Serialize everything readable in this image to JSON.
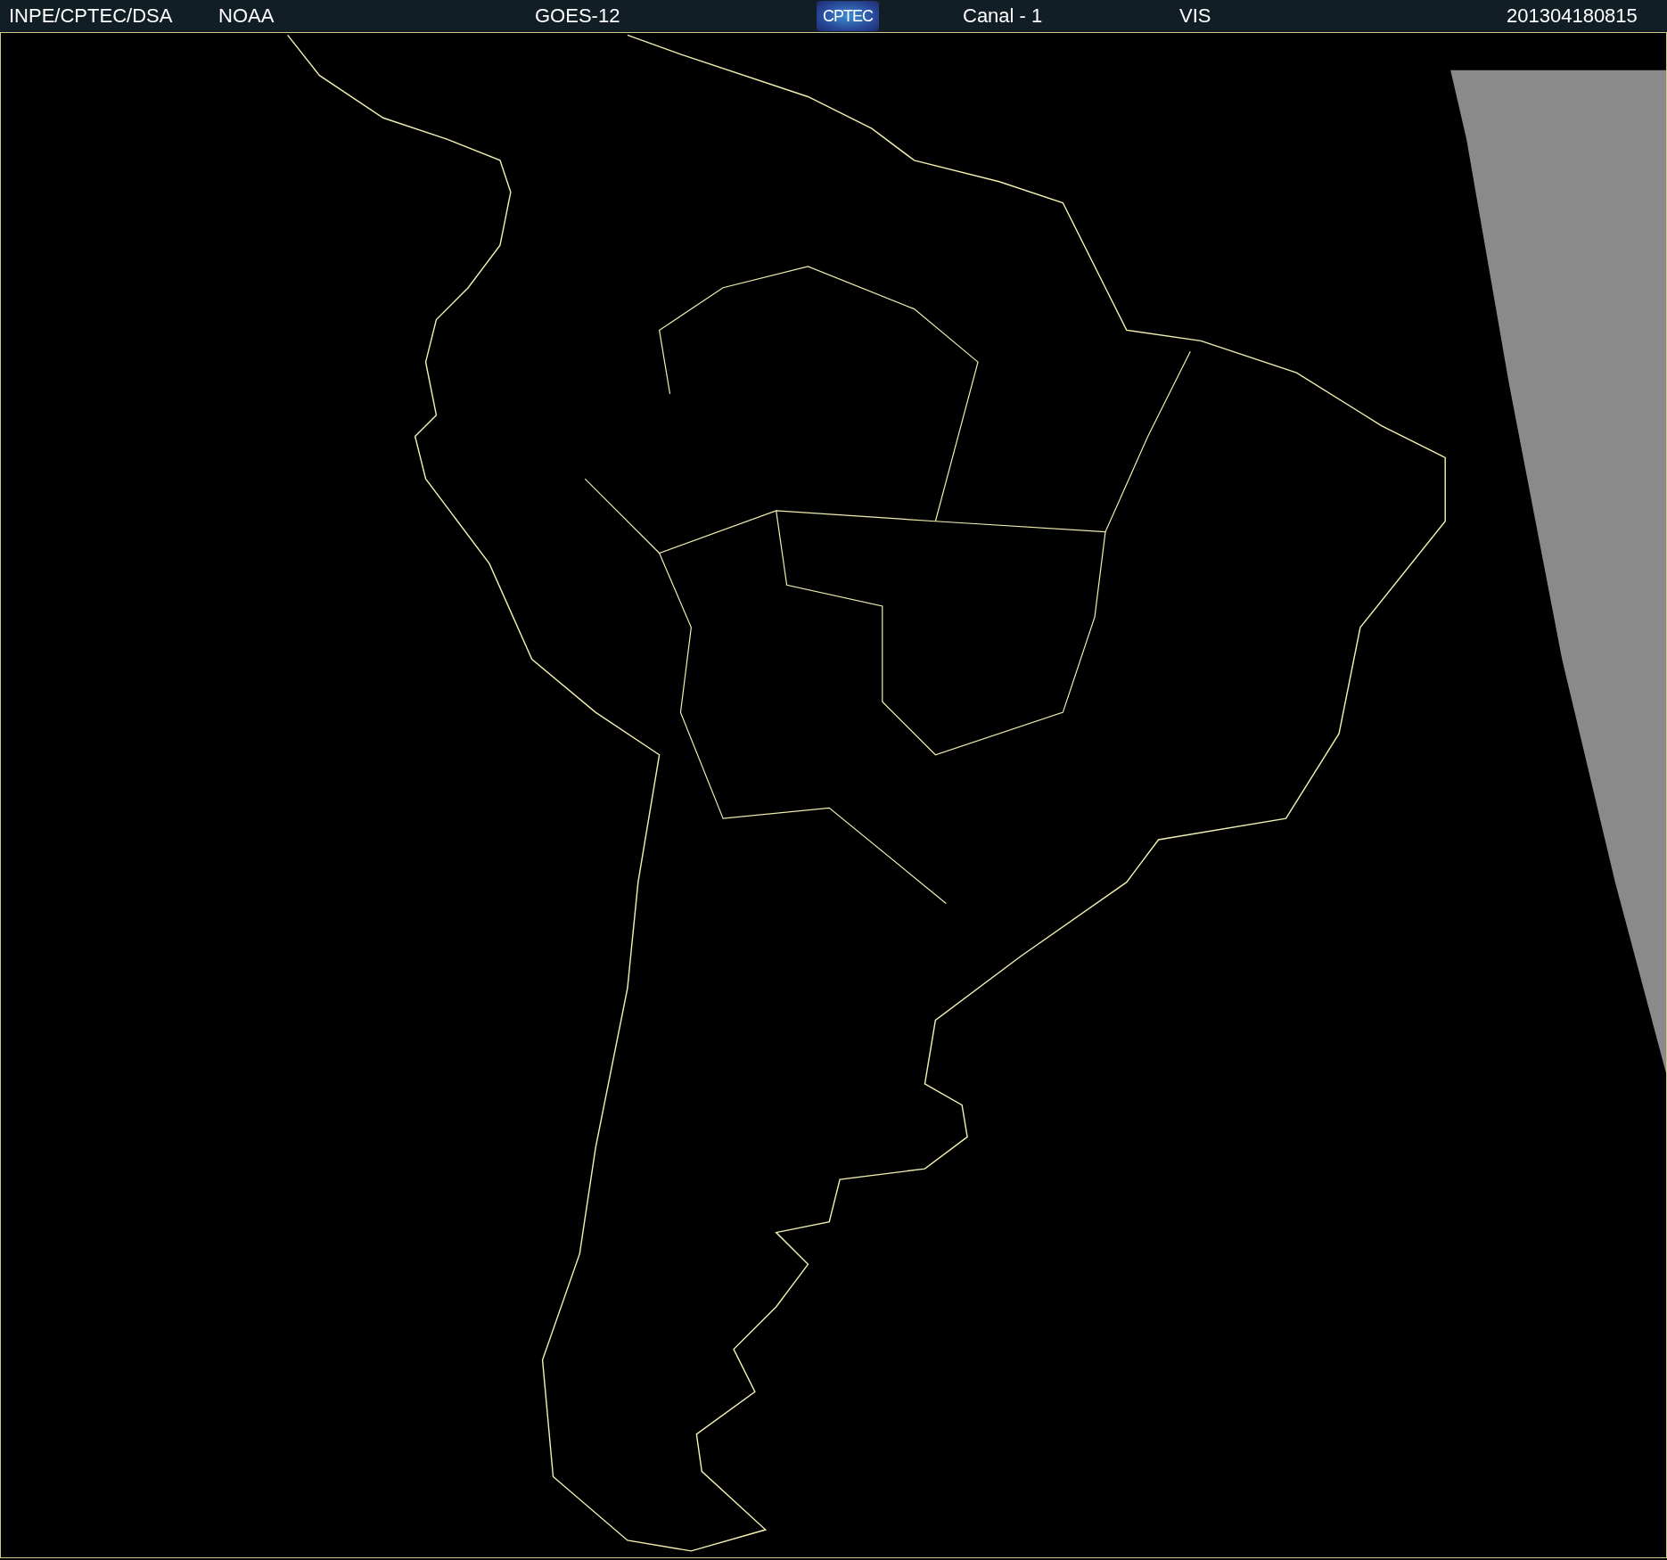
{
  "header": [
    {
      "kind": "text",
      "text": "INPE/CPTEC/DSA"
    },
    {
      "kind": "text",
      "text": "NOAA"
    },
    {
      "kind": "text",
      "text": "GOES-12"
    },
    {
      "kind": "logo",
      "text": "CPTEC"
    },
    {
      "kind": "text",
      "text": "Canal - 1"
    },
    {
      "kind": "text",
      "text": "VIS"
    },
    {
      "kind": "text",
      "text": "201304180815"
    }
  ]
}
